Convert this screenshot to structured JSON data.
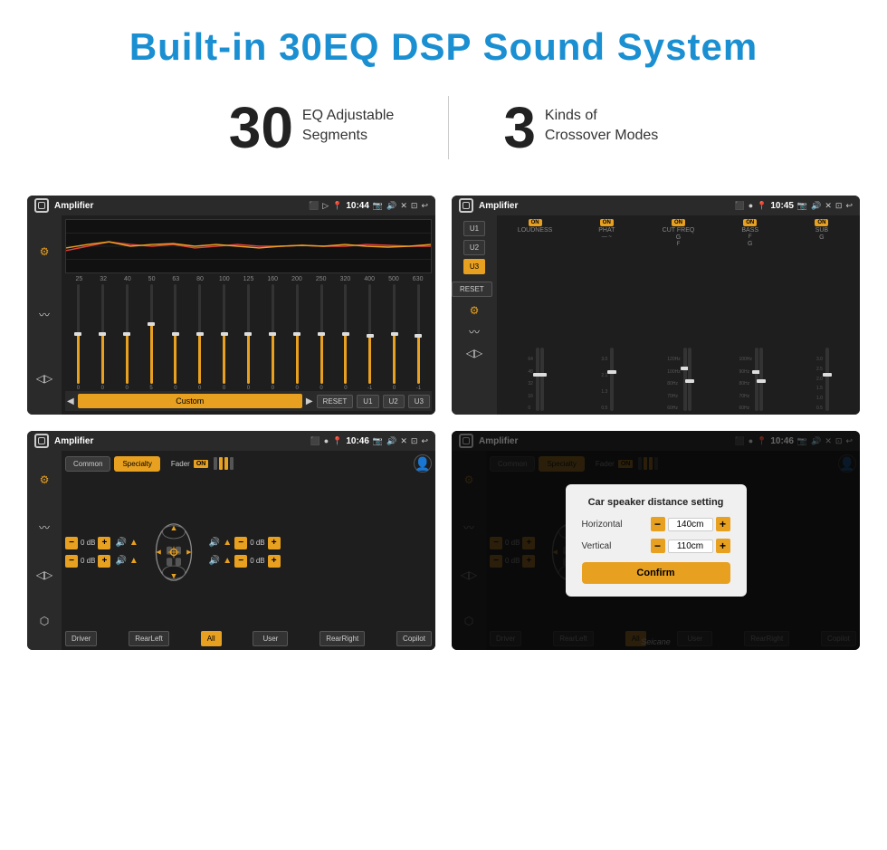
{
  "header": {
    "title": "Built-in 30EQ DSP Sound System",
    "title_color": "#1a8fd1"
  },
  "stats": [
    {
      "number": "30",
      "description": "EQ Adjustable\nSegments"
    },
    {
      "number": "3",
      "description": "Kinds of\nCrossover Modes"
    }
  ],
  "screens": [
    {
      "id": "screen1",
      "title": "Amplifier",
      "time": "10:44",
      "type": "eq_sliders",
      "frequencies": [
        "25",
        "32",
        "40",
        "50",
        "63",
        "80",
        "100",
        "125",
        "160",
        "200",
        "250",
        "320",
        "400",
        "500",
        "630"
      ],
      "values": [
        0,
        0,
        0,
        5,
        0,
        0,
        0,
        0,
        0,
        0,
        0,
        0,
        -1,
        0,
        -1
      ],
      "presets": [
        "Custom",
        "RESET",
        "U1",
        "U2",
        "U3"
      ],
      "active_preset": "Custom"
    },
    {
      "id": "screen2",
      "title": "Amplifier",
      "time": "10:45",
      "type": "dsp_crossover",
      "presets": [
        "U1",
        "U2",
        "U3"
      ],
      "active_preset": "U3",
      "channels": [
        {
          "label": "LOUDNESS",
          "on": true
        },
        {
          "label": "PHAT",
          "on": true
        },
        {
          "label": "CUT FREQ",
          "on": true
        },
        {
          "label": "BASS",
          "on": true
        },
        {
          "label": "SUB",
          "on": true
        }
      ],
      "reset_label": "RESET"
    },
    {
      "id": "screen3",
      "title": "Amplifier",
      "time": "10:46",
      "type": "specialty",
      "buttons": [
        "Common",
        "Specialty"
      ],
      "active_button": "Specialty",
      "fader_label": "Fader",
      "fader_on": true,
      "controls": [
        {
          "label": "0 dB"
        },
        {
          "label": "0 dB"
        },
        {
          "label": "0 dB"
        },
        {
          "label": "0 dB"
        }
      ],
      "zones": [
        "Driver",
        "RearLeft",
        "All",
        "User",
        "RearRight",
        "Copilot"
      ]
    },
    {
      "id": "screen4",
      "title": "Amplifier",
      "time": "10:46",
      "type": "specialty_modal",
      "buttons": [
        "Common",
        "Specialty"
      ],
      "active_button": "Specialty",
      "modal": {
        "title": "Car speaker distance setting",
        "horizontal_label": "Horizontal",
        "horizontal_value": "140cm",
        "vertical_label": "Vertical",
        "vertical_value": "110cm",
        "confirm_label": "Confirm"
      }
    }
  ],
  "watermark": "Seicane"
}
